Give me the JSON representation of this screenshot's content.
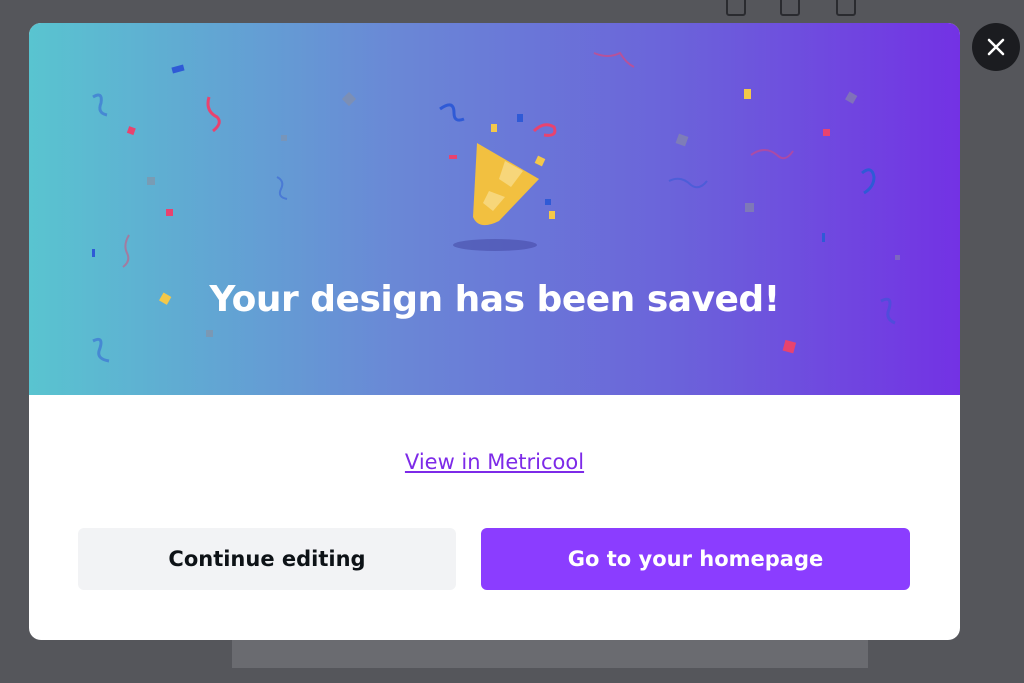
{
  "dialog": {
    "title": "Your design has been saved!",
    "link_label": "View in Metricool",
    "continue_label": "Continue editing",
    "homepage_label": "Go to your homepage",
    "close_icon": "close-icon",
    "illustration": "party-popper-icon"
  },
  "colors": {
    "primary": "#8b3dff",
    "link": "#7d2ae8",
    "gradient_start": "#59c4d0",
    "gradient_end": "#7332e4"
  },
  "topbar": {
    "icons": [
      "lock-icon",
      "add-page-icon",
      "duplicate-icon"
    ]
  }
}
